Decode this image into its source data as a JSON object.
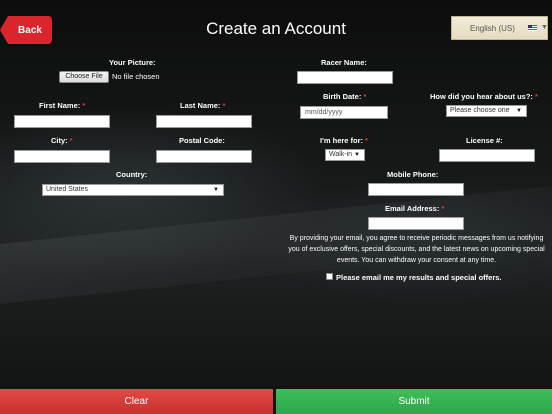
{
  "header": {
    "back_label": "Back",
    "title": "Create an Account",
    "language": "English (US)"
  },
  "form": {
    "picture_label": "Your Picture:",
    "file_button": "Choose File",
    "file_status": "No file chosen",
    "first_name_label": "First Name:",
    "last_name_label": "Last Name:",
    "city_label": "City:",
    "postal_label": "Postal Code:",
    "country_label": "Country:",
    "country_value": "United States",
    "racer_name_label": "Racer Name:",
    "birth_date_label": "Birth Date:",
    "birth_date_placeholder": "mm/dd/yyyy",
    "heard_label": "How did you hear about us?:",
    "heard_value": "Please choose one",
    "here_for_label": "I'm here for:",
    "here_for_value": "Walk-in",
    "license_label": "License #:",
    "mobile_label": "Mobile Phone:",
    "email_label": "Email Address:",
    "required_mark": "*",
    "consent_text": "By providing your email, you agree to receive periodic messages from us notifying you of exclusive offers, special discounts, and the latest news on upcoming special events. You can withdraw your consent at any time.",
    "optin_label": "Please email me my results and special offers."
  },
  "footer": {
    "clear_label": "Clear",
    "submit_label": "Submit"
  },
  "colors": {
    "back": "#d9252b",
    "clear": "#d9534f",
    "submit": "#3cb556",
    "required": "#e03a3a"
  }
}
